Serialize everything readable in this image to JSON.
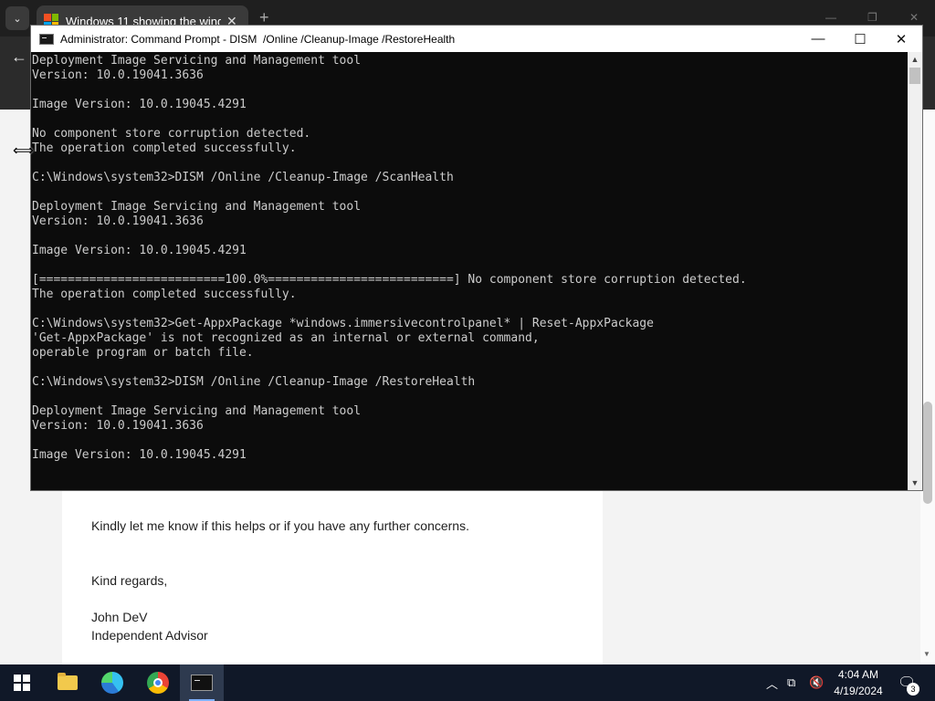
{
  "browser": {
    "tab_title": "Windows 11 showing the wind",
    "tab_close_glyph": "✕",
    "new_tab_glyph": "+",
    "back_glyph": "←"
  },
  "page": {
    "lines": [
      "Kindly let me know if this helps or if you have any further concerns.",
      "Kind regards,",
      "John DeV",
      "Independent Advisor"
    ]
  },
  "cmd": {
    "title": "Administrator: Command Prompt - DISM  /Online /Cleanup-Image /RestoreHealth",
    "minimize_glyph": "—",
    "maximize_glyph": "☐",
    "close_glyph": "✕",
    "lines": [
      "Deployment Image Servicing and Management tool",
      "Version: 10.0.19041.3636",
      "",
      "Image Version: 10.0.19045.4291",
      "",
      "No component store corruption detected.",
      "The operation completed successfully.",
      "",
      "C:\\Windows\\system32>DISM /Online /Cleanup-Image /ScanHealth",
      "",
      "Deployment Image Servicing and Management tool",
      "Version: 10.0.19041.3636",
      "",
      "Image Version: 10.0.19045.4291",
      "",
      "[==========================100.0%==========================] No component store corruption detected.",
      "The operation completed successfully.",
      "",
      "C:\\Windows\\system32>Get-AppxPackage *windows.immersivecontrolpanel* | Reset-AppxPackage",
      "'Get-AppxPackage' is not recognized as an internal or external command,",
      "operable program or batch file.",
      "",
      "C:\\Windows\\system32>DISM /Online /Cleanup-Image /RestoreHealth",
      "",
      "Deployment Image Servicing and Management tool",
      "Version: 10.0.19041.3636",
      "",
      "Image Version: 10.0.19045.4291"
    ]
  },
  "taskbar": {
    "time": "4:04 AM",
    "date": "4/19/2024",
    "notification_count": "3",
    "apps": [
      "start",
      "file-explorer",
      "edge",
      "chrome",
      "command-prompt"
    ]
  },
  "colors": {
    "cmd_background": "#0c0c0c",
    "cmd_text": "#cccccc",
    "taskbar": "#101828"
  }
}
